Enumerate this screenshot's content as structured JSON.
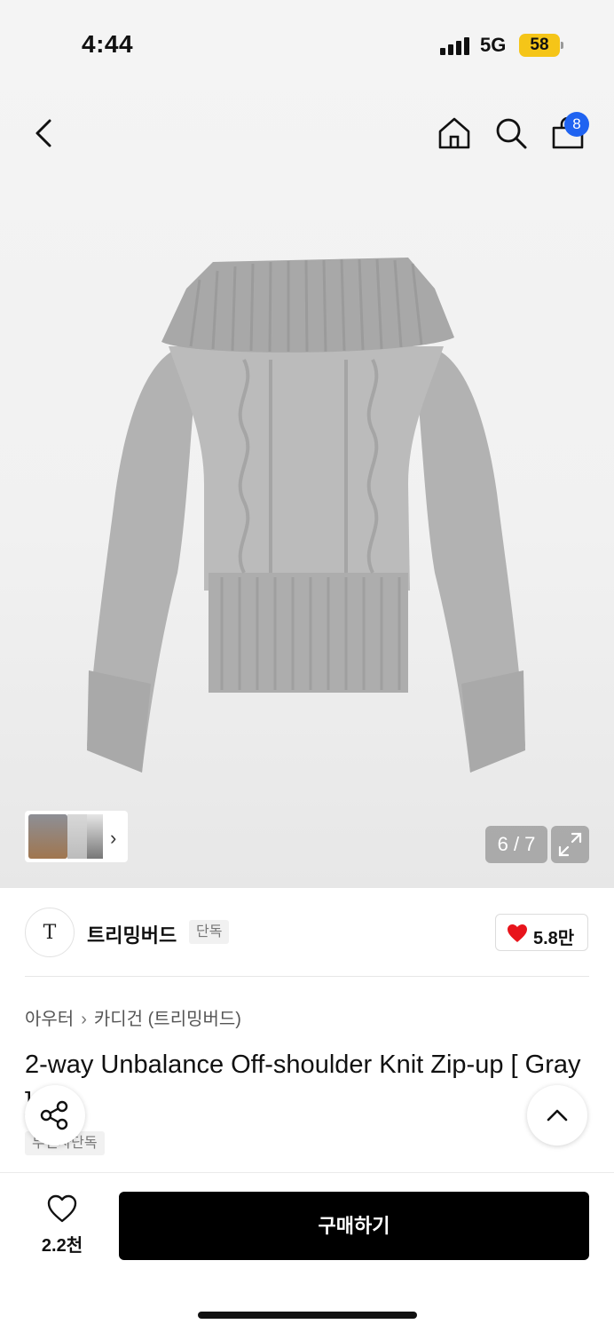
{
  "status_bar": {
    "time": "4:44",
    "network": "5G",
    "battery": "58"
  },
  "nav": {
    "cart_count": "8"
  },
  "gallery": {
    "counter": "6 / 7"
  },
  "brand": {
    "logo_letter": "T",
    "name": "트리밍버드",
    "tag": "단독",
    "likes": "5.8만"
  },
  "breadcrumb": {
    "level1": "아우터",
    "level2": "카디건 (트리밍버드)"
  },
  "product": {
    "title": "2-way Unbalance Off-shoulder Knit Zip-up [ Gray ]",
    "tag": "무신사단독"
  },
  "bottom": {
    "wish_count": "2.2천",
    "buy_label": "구매하기"
  },
  "colors": {
    "accent_blue": "#1f63f1",
    "heart_red": "#e8141b",
    "battery_yellow": "#f5c518",
    "buy_bg": "#000000",
    "sweater_gray": "#b4b4b4"
  },
  "icons": [
    "back-icon",
    "home-icon",
    "search-icon",
    "cart-icon",
    "chevron-right-icon",
    "expand-icon",
    "heart-icon",
    "share-icon",
    "chevron-up-icon"
  ]
}
